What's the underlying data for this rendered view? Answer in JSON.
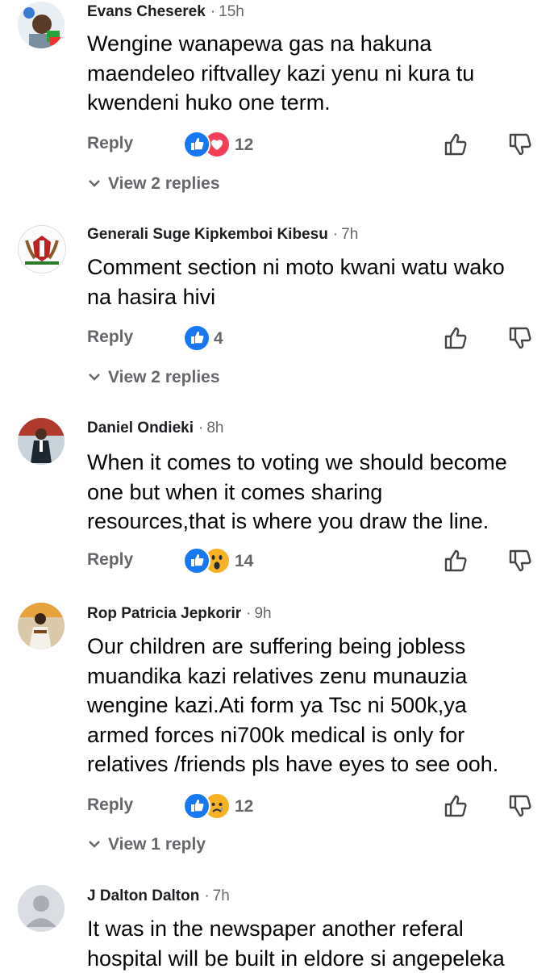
{
  "ui": {
    "reply_label": "Reply",
    "separator": "·"
  },
  "comments": [
    {
      "author": "Evans Cheserek",
      "time": "15h",
      "lines": [
        "Wengine wanapewa gas  na hakuna",
        "maendeleo riftvalley kazi yenu ni kura tu",
        "kwendeni huko one term."
      ],
      "reaction_count": "12",
      "reactions": [
        "like-icon",
        "love-icon"
      ],
      "view_replies": "View 2 replies"
    },
    {
      "author": "Generali Suge Kipkemboi Kibesu",
      "time": "7h",
      "lines": [
        "Comment section ni moto kwani watu wako",
        "na hasira hivi"
      ],
      "reaction_count": "4",
      "reactions": [
        "like-icon"
      ],
      "view_replies": "View 2 replies"
    },
    {
      "author": "Daniel Ondieki",
      "time": "8h",
      "lines": [
        "When it comes to voting we should become",
        "one but when it comes sharing",
        "resources,that is where you draw the line."
      ],
      "reaction_count": "14",
      "reactions": [
        "like-icon",
        "wow-icon"
      ],
      "view_replies": ""
    },
    {
      "author": "Rop Patricia Jepkorir",
      "time": "9h",
      "lines": [
        "Our children are suffering being jobless",
        "muandika kazi relatives zenu munauzia",
        "wengine kazi.Ati form ya Tsc ni 500k,ya",
        "armed forces ni700k  medical is only for",
        "relatives /friends  pls have eyes to see ooh."
      ],
      "reaction_count": "12",
      "reactions": [
        "like-icon",
        "sad-icon"
      ],
      "view_replies": "View 1 reply"
    },
    {
      "author": "J Dalton Dalton",
      "time": "7h",
      "lines": [
        "It was in the newspaper another referal",
        "hospital  will be built in eldore si angepeleka"
      ]
    }
  ],
  "colors": {
    "like": "#1877f2",
    "love": "#f33e58",
    "wow": "#f7b125",
    "muted": "#65676b"
  }
}
